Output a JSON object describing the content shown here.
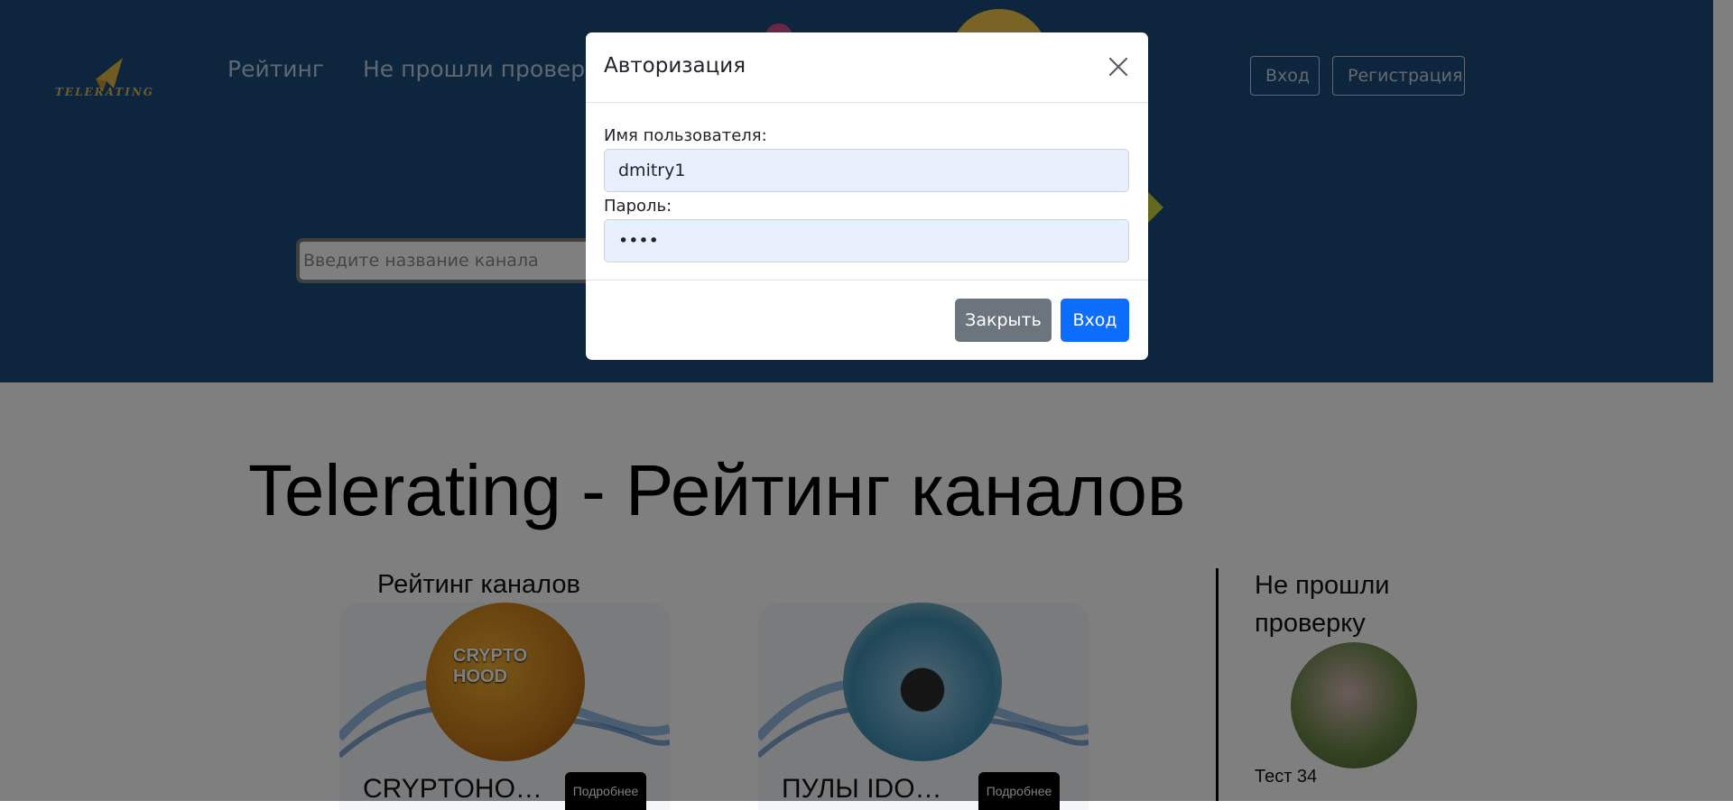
{
  "header": {
    "logo_text": "TELERATING",
    "nav": [
      "Рейтинг",
      "Не прошли проверку"
    ],
    "login_label": "Вход",
    "register_label": "Регистрация",
    "search_placeholder": "Введите название канала"
  },
  "main": {
    "title": "Telerating - Рейтинг каналов",
    "rating_title": "Рейтинг каналов",
    "cards": [
      {
        "avatar_text": "CRYPTO HOOD",
        "name": "CRYPTOHO…",
        "more_label": "Подробнее"
      },
      {
        "name": "ПУЛЫ IDO…",
        "more_label": "Подробнее"
      }
    ],
    "failed_title": "Не прошли проверку",
    "failed_items": [
      {
        "name": "Тест 34"
      }
    ]
  },
  "modal": {
    "title": "Авторизация",
    "username_label": "Имя пользователя:",
    "username_value": "dmitry1",
    "password_label": "Пароль:",
    "password_value": "1234",
    "close_label": "Закрыть",
    "submit_label": "Вход"
  },
  "colors": {
    "header_bg": "#1d4c7a",
    "primary": "#0d6efd",
    "secondary": "#6c757d",
    "autofill_bg": "#e8f0fe"
  }
}
